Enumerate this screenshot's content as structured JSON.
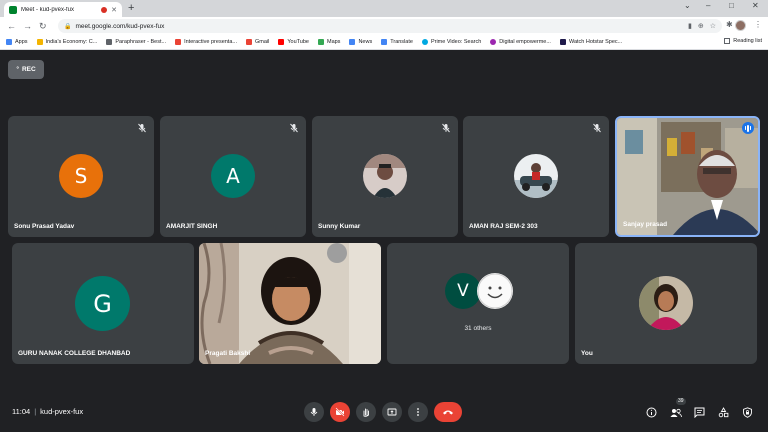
{
  "browser": {
    "tab_title": "Meet - kud-pvex-fux",
    "new_tab": "+",
    "url": "meet.google.com/kud-pvex-fux",
    "window_controls": [
      "⌄",
      "–",
      "□",
      "✕"
    ]
  },
  "bookmarks": [
    {
      "label": "Apps",
      "color": "#4285f4"
    },
    {
      "label": "India's Economy: C...",
      "color": "#f4b400"
    },
    {
      "label": "Paraphraser - Best...",
      "color": "#5f6368"
    },
    {
      "label": "Interactive presenta...",
      "color": "#ea4335"
    },
    {
      "label": "Gmail",
      "color": "#ea4335"
    },
    {
      "label": "YouTube",
      "color": "#ff0000"
    },
    {
      "label": "Maps",
      "color": "#34a853"
    },
    {
      "label": "News",
      "color": "#4285f4"
    },
    {
      "label": "Translate",
      "color": "#4285f4"
    },
    {
      "label": "Prime Video: Search",
      "color": "#00a8e1"
    },
    {
      "label": "Digital empowerme...",
      "color": "#9c27b0"
    },
    {
      "label": "Watch Hotstar Spec...",
      "color": "#1f1a4b"
    }
  ],
  "reading_list": "Reading list",
  "recording": {
    "label": "REC"
  },
  "participants": {
    "sonu": {
      "name": "Sonu Prasad Yadav",
      "initial": "S",
      "color": "#e8710a"
    },
    "amarjit": {
      "name": "AMARJIT SINGH",
      "initial": "A",
      "color": "#00796b"
    },
    "sunny": {
      "name": "Sunny Kumar"
    },
    "aman": {
      "name": "AMAN RAJ SEM-2 303"
    },
    "sanjay": {
      "name": "Sanjay prasad"
    },
    "guru": {
      "name": "GURU NANAK COLLEGE DHANBAD",
      "initial": "G",
      "color": "#00796b"
    },
    "pragati": {
      "name": "Pragati Bakshi"
    },
    "others": {
      "initial": "V",
      "color": "#004d40",
      "label": "31 others"
    },
    "you": {
      "name": "You"
    }
  },
  "meeting": {
    "time": "11:04",
    "separator": "|",
    "code": "kud-pvex-fux",
    "participant_count": "39"
  }
}
